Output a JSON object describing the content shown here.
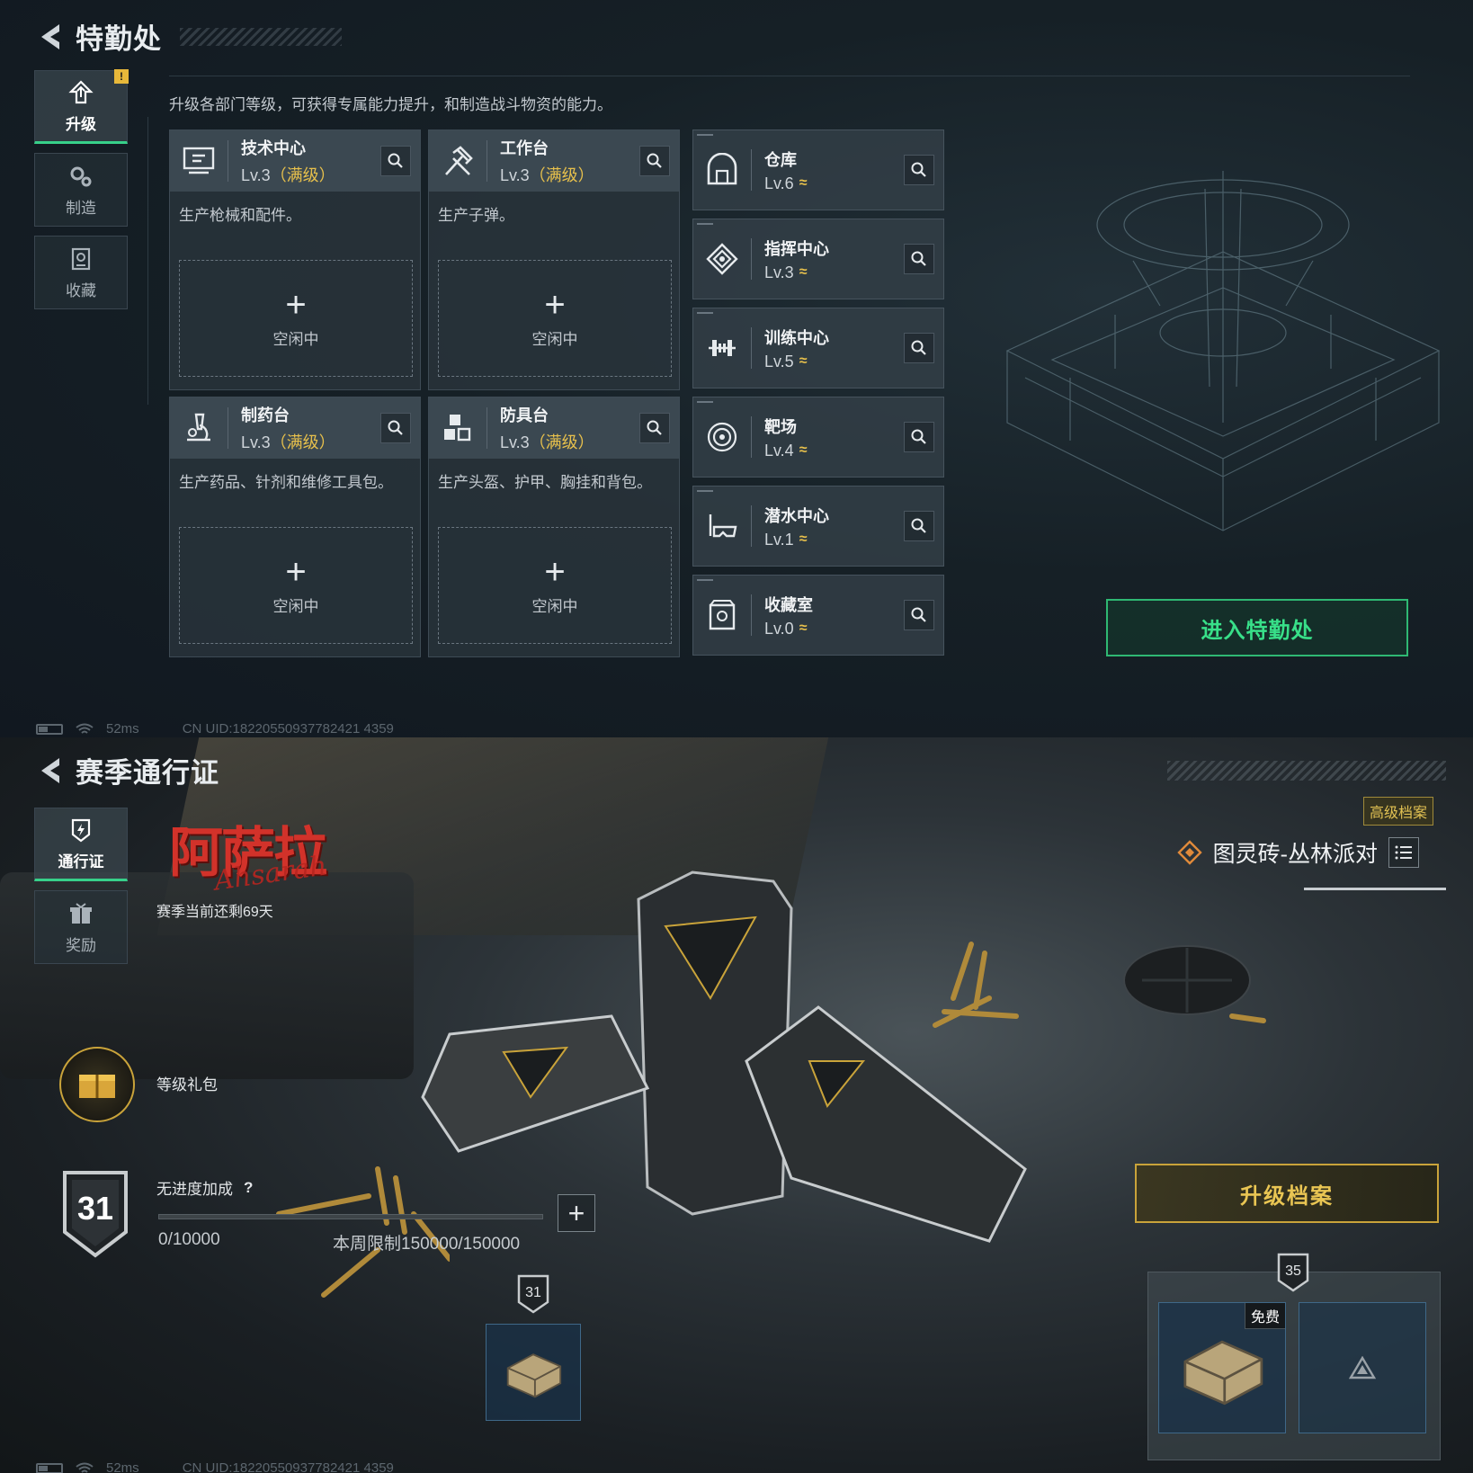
{
  "top": {
    "title": "特勤处",
    "side_nav": [
      {
        "label": "升级",
        "icon": "upgrade-icon",
        "active": true,
        "alert": "!"
      },
      {
        "label": "制造",
        "icon": "gears-icon",
        "active": false
      },
      {
        "label": "收藏",
        "icon": "collection-icon",
        "active": false
      }
    ],
    "description": "升级各部门等级，可获得专属能力提升，和制造战斗物资的能力。",
    "production": [
      {
        "name": "技术中心",
        "level": "Lv.3",
        "max": "（满级）",
        "desc": "生产枪械和配件。",
        "idle_plus": "+",
        "idle": "空闲中",
        "icon": "monitor-icon"
      },
      {
        "name": "工作台",
        "level": "Lv.3",
        "max": "（满级）",
        "desc": "生产子弹。",
        "idle_plus": "+",
        "idle": "空闲中",
        "icon": "hammer-icon"
      },
      {
        "name": "制药台",
        "level": "Lv.3",
        "max": "（满级）",
        "desc": "生产药品、针剂和维修工具包。",
        "idle_plus": "+",
        "idle": "空闲中",
        "icon": "microscope-icon"
      },
      {
        "name": "防具台",
        "level": "Lv.3",
        "max": "（满级）",
        "desc": "生产头盔、护甲、胸挂和背包。",
        "idle_plus": "+",
        "idle": "空闲中",
        "icon": "armor-icon"
      }
    ],
    "departments": [
      {
        "name": "仓库",
        "level": "Lv.6",
        "icon": "warehouse-icon"
      },
      {
        "name": "指挥中心",
        "level": "Lv.3",
        "icon": "command-icon"
      },
      {
        "name": "训练中心",
        "level": "Lv.5",
        "icon": "dumbbell-icon"
      },
      {
        "name": "靶场",
        "level": "Lv.4",
        "icon": "target-icon"
      },
      {
        "name": "潜水中心",
        "level": "Lv.1",
        "icon": "dive-mask-icon"
      },
      {
        "name": "收藏室",
        "level": "Lv.0",
        "icon": "vault-icon"
      }
    ],
    "upgrade_glyph": "≈",
    "enter_button": "进入特勤处",
    "status": {
      "ping": "52ms",
      "uid": "CN UID:18220550937782421 4359"
    }
  },
  "bottom": {
    "title": "赛季通行证",
    "side_nav": [
      {
        "label": "通行证",
        "icon": "pass-icon",
        "active": true
      },
      {
        "label": "奖励",
        "icon": "gift-icon",
        "active": false
      }
    ],
    "season_logo_cn": "阿萨拉",
    "season_logo_en": "Ahsarah",
    "season_remaining": "赛季当前还剩69天",
    "advanced_tag": "高级档案",
    "pass_name": "图灵砖-丛林派对",
    "gift_label": "等级礼包",
    "level": "31",
    "no_bonus": "无进度加成",
    "help": "?",
    "xp_progress": 0,
    "xp_value": "0/10000",
    "weekly_limit": "本周限制150000/150000",
    "plus": "+",
    "current_tier": "31",
    "next_tier": "35",
    "free_tag": "免费",
    "upgrade_button": "升级档案",
    "status": {
      "ping": "52ms",
      "uid": "CN UID:18220550937782421 4359"
    }
  },
  "colors": {
    "accent_green": "#37d08a",
    "gold": "#e7c04c",
    "brand_red": "#d2322a"
  }
}
